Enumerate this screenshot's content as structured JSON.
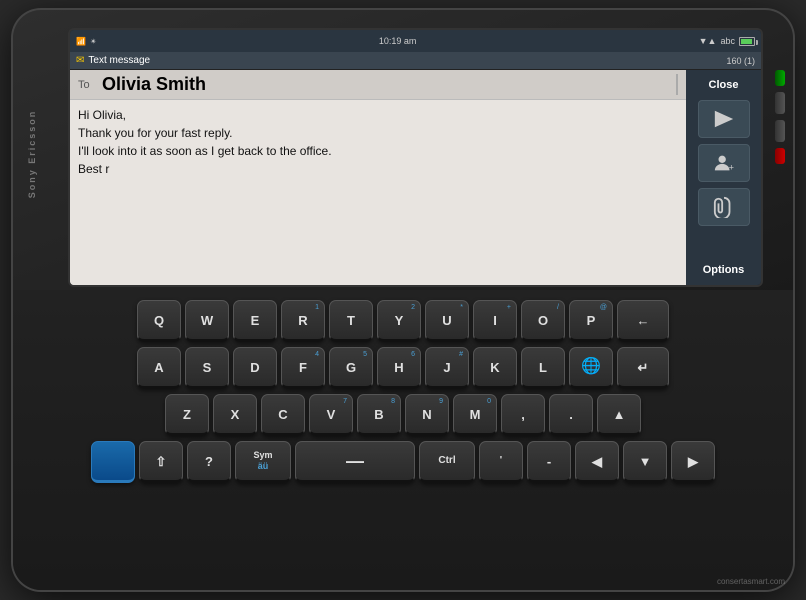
{
  "phone": {
    "brand": "Sony Ericsson",
    "watermark": "consertasmart.com"
  },
  "status_bar": {
    "time": "10:19 am",
    "signal_label": "signal",
    "bluetooth_label": "bluetooth",
    "abc_label": "abc"
  },
  "message": {
    "header_icon": "✉",
    "header_type": "Text message",
    "char_count": "160 (1)",
    "signal_strength": "▼▲ abc",
    "to_label": "To",
    "recipient": "Olivia Smith",
    "body_line1": "Hi Olivia,",
    "body_line2": "Thank you for your fast reply.",
    "body_line3": "I'll look into it as soon as I get back to the office.",
    "body_line4": "Best r"
  },
  "panel": {
    "close_label": "Close",
    "options_label": "Options"
  },
  "keyboard": {
    "row1": [
      "Q",
      "W",
      "E",
      "R",
      "T",
      "Y",
      "U",
      "I",
      "O",
      "P"
    ],
    "row1_sub": [
      "",
      "",
      "",
      "1",
      "",
      "2",
      "*",
      "+",
      "/",
      "@"
    ],
    "row2": [
      "A",
      "S",
      "D",
      "F",
      "G",
      "H",
      "J",
      "K",
      "L",
      ""
    ],
    "row2_sub": [
      "",
      "",
      "",
      "4",
      "5",
      "6",
      "#",
      "",
      "",
      ""
    ],
    "row3": [
      "Z",
      "X",
      "C",
      "V",
      "B",
      "N",
      "M",
      ",",
      ".",
      ""
    ],
    "row3_sub": [
      "",
      "",
      "",
      "7",
      "8",
      "9",
      "0",
      "",
      "",
      ""
    ],
    "backspace_label": "←",
    "enter_label": "↵",
    "globe_label": "🌐",
    "shift_label": "⇧",
    "sym_label": "Sym\näü",
    "space_label": "—",
    "ctrl_label": "Ctrl",
    "left_label": "◀",
    "up_label": "▲",
    "down_label": "▼",
    "right_label": "▶"
  }
}
